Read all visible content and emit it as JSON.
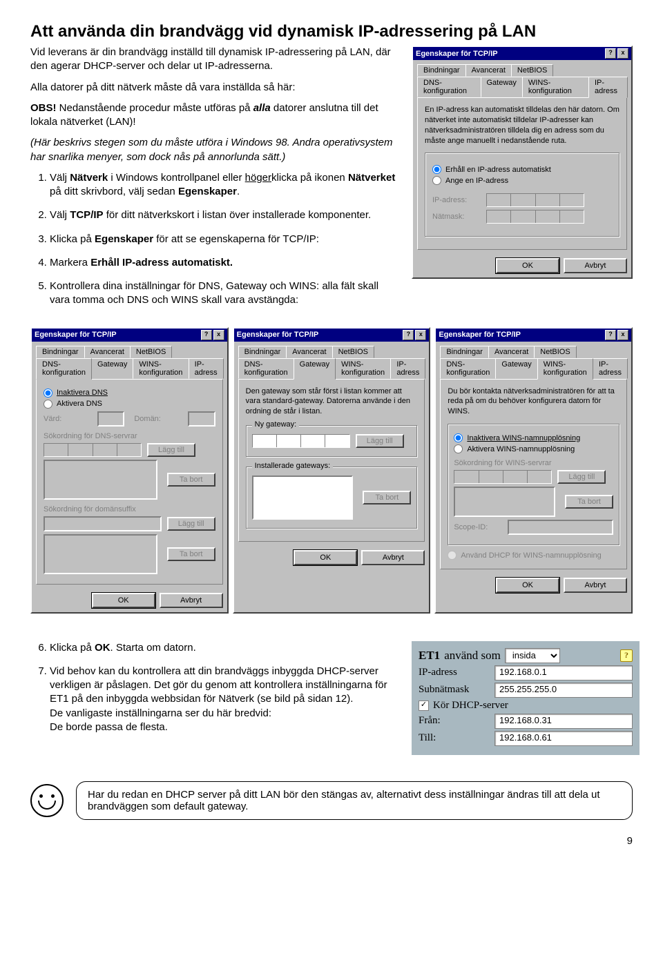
{
  "heading": "Att använda din brandvägg vid dynamisk IP-adressering på LAN",
  "intro": "Vid leverans är din brandvägg inställd till dynamisk IP-adressering på LAN, där den agerar DHCP-server och delar ut IP-adresserna.",
  "line2": "Alla datorer på ditt nätverk måste då vara inställda så här:",
  "obs_label": "OBS!",
  "obs_text": " Nedanstående procedur måste utföras på ",
  "obs_bold": "alla",
  "obs_tail": " datorer anslutna till det lokala nätverket (LAN)!",
  "italic_note": "(Här beskrivs stegen som du måste utföra i Windows 98. Andra operativsystem har snarlika menyer, som dock nås på annorlunda sätt.)",
  "steps": {
    "s1a": "Välj ",
    "s1b": "Nätverk",
    "s1c": " i Windows kontrollpanel eller ",
    "s1d": "höger",
    "s1e": "klicka på ikonen ",
    "s1f": "Nätverket",
    "s1g": " på ditt skrivbord, välj sedan ",
    "s1h": "Egenskaper",
    "s1i": ".",
    "s2a": "Välj ",
    "s2b": "TCP/IP",
    "s2c": " för ditt nätverkskort i listan över installerade komponenter.",
    "s3a": "Klicka på ",
    "s3b": "Egenskaper",
    "s3c": " för att se egenskaperna för TCP/IP:",
    "s4a": "Markera ",
    "s4b": "Erhåll IP-adress automatiskt.",
    "s5": "Kontrollera dina inställningar för DNS, Gateway och WINS: alla fält skall vara tomma och DNS och WINS skall vara avstängda:",
    "s6a": "Klicka på ",
    "s6b": "OK",
    "s6c": ". Starta om datorn.",
    "s7a": "Vid behov kan du kontrollera att din brandväggs inbyggda DHCP-server verkligen är påslagen. Det gör du genom att kontrollera inställningarna för ET1 på den inbyggda webbsidan för Nätverk (se bild på sidan 12).",
    "s7b": "De vanligaste inställningarna ser du här bredvid:",
    "s7c": "De borde passa de flesta."
  },
  "dialog": {
    "title": "Egenskaper för TCP/IP",
    "help": "?",
    "close": "x",
    "tabs": {
      "bind": "Bindningar",
      "adv": "Avancerat",
      "netbios": "NetBIOS",
      "dns": "DNS-konfiguration",
      "gw": "Gateway",
      "wins": "WINS-konfiguration",
      "ip": "IP-adress"
    },
    "ip_desc": "En IP-adress kan automatiskt tilldelas den här datorn. Om nätverket inte automatiskt tilldelar IP-adresser kan nätverksadministratören tilldela dig en adress som du måste ange manuellt i nedanstående ruta.",
    "r1": "Erhåll en IP-adress automatiskt",
    "r2": "Ange en IP-adress",
    "ipaddr": "IP-adress:",
    "netmask": "Nätmask:",
    "ok": "OK",
    "cancel": "Avbryt",
    "dns_off": "Inaktivera DNS",
    "dns_on": "Aktivera DNS",
    "host": "Värd:",
    "domain": "Domän:",
    "dns_search": "Sökordning för DNS-servrar",
    "suffix_search": "Sökordning för domänsuffix",
    "add": "Lägg till",
    "remove": "Ta bort",
    "gw_desc": "Den gateway som står först i listan kommer att vara standard-gateway. Datorerna använde i den ordning de står i listan.",
    "new_gw": "Ny gateway:",
    "inst_gw": "Installerade gateways:",
    "wins_desc": "Du bör kontakta nätverksadministratören för att ta reda på om du behöver konfigurera datorn för WINS.",
    "wins_off": "Inaktivera WINS-namnupplösning",
    "wins_on": "Aktivera WINS-namnupplösning",
    "wins_search": "Sökordning för WINS-servrar",
    "scope": "Scope-ID:",
    "dhcp_wins": "Använd DHCP för WINS-namnupplösning"
  },
  "et1": {
    "head1": "ET1",
    "head2": " använd som ",
    "sel": "insida",
    "ip_lab": "IP-adress",
    "ip_val": "192.168.0.1",
    "mask_lab": "Subnätmask",
    "mask_val": "255.255.255.0",
    "dhcp": "Kör DHCP-server",
    "from_lab": "Från:",
    "from_val": "192.168.0.31",
    "to_lab": "Till:",
    "to_val": "192.168.0.61",
    "help": "?"
  },
  "footnote": "Har du redan en DHCP server på ditt LAN bör den stängas av, alternativt dess inställningar ändras till att dela ut brandväggen som default gateway.",
  "pagenum": "9"
}
